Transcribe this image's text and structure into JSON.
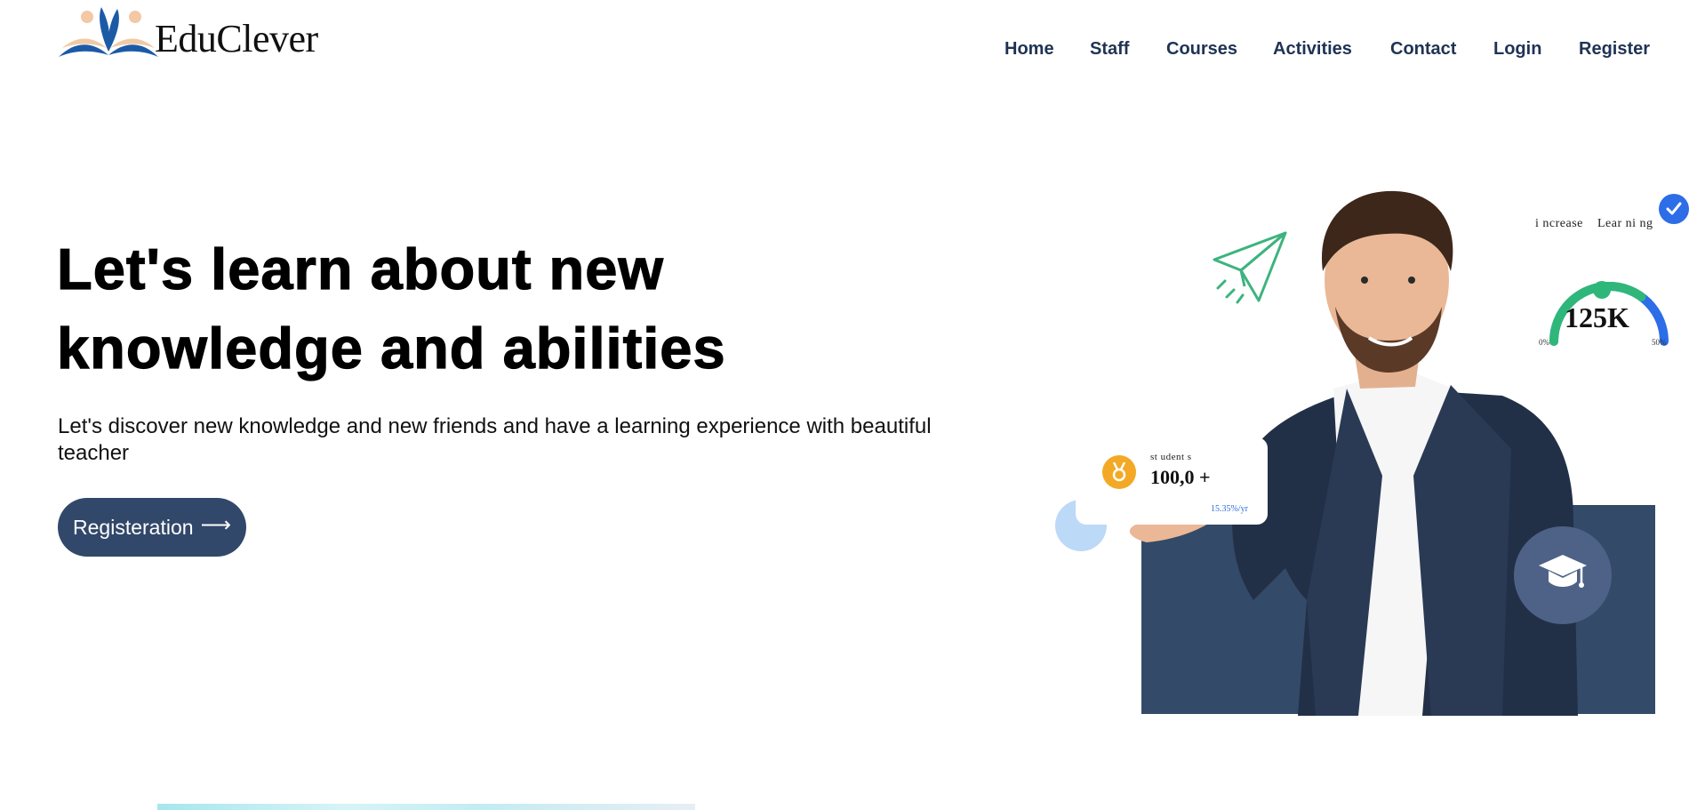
{
  "brand": {
    "name": "EduClever",
    "colors": {
      "primary": "#32486a",
      "navy_block": "#344a69",
      "green": "#2fb77a",
      "blue": "#2d6de8",
      "orange": "#f3a925"
    }
  },
  "nav": {
    "items": [
      "Home",
      "Staff",
      "Courses",
      "Activities",
      "Contact",
      "Login",
      "Register"
    ]
  },
  "hero": {
    "title_line1": "Let's learn about new",
    "title_line2": "knowledge and abilities",
    "subtitle": "Let's discover new knowledge and new friends and have a learning experience with beautiful teacher",
    "cta_label": "Registeration"
  },
  "stats_card": {
    "label": "st udent s",
    "value": "100,0 +",
    "rate": "15.35%/yr"
  },
  "gauge": {
    "label_left": "i ncrease",
    "label_right": "Lear ni ng",
    "value": "125K",
    "min_label": "0%",
    "max_label": "50%",
    "level": 0.7
  },
  "icons": [
    "educlever-logo",
    "paper-plane-icon",
    "medal-icon",
    "graduation-cap-icon",
    "check-icon",
    "teacher-photo"
  ]
}
